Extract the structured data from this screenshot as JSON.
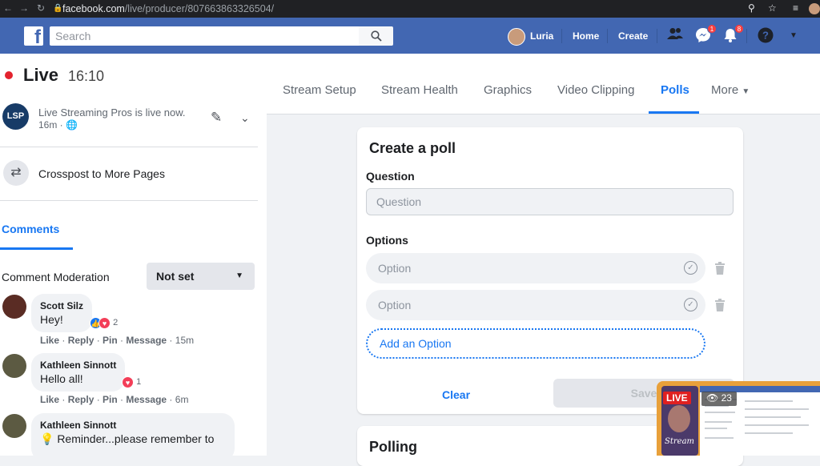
{
  "browser": {
    "url_host": "facebook.com",
    "url_path": "/live/producer/807663863326504/"
  },
  "fb": {
    "search_placeholder": "Search",
    "user_name": "Luria",
    "home_label": "Home",
    "create_label": "Create",
    "messenger_badge": "1",
    "notifications_badge": "8"
  },
  "live": {
    "label": "Live",
    "time": "16:10",
    "page_initials": "LSP",
    "status_text": "Live Streaming Pros is live now.",
    "ago": "16m ·",
    "crosspost_label": "Crosspost to More Pages"
  },
  "comments": {
    "tab_label": "Comments",
    "moderation_label": "Comment Moderation",
    "moderation_value": "Not set",
    "items": [
      {
        "name": "Scott Silz",
        "text": "Hey!",
        "reactions": "2",
        "age": "15m"
      },
      {
        "name": "Kathleen Sinnott",
        "text": "Hello all!",
        "reactions": "1",
        "age": "6m"
      },
      {
        "name": "Kathleen Sinnott",
        "text": "💡 Reminder...please remember to"
      }
    ],
    "action_like": "Like",
    "action_reply": "Reply",
    "action_pin": "Pin",
    "action_message": "Message"
  },
  "tabs": {
    "items": [
      "Stream Setup",
      "Stream Health",
      "Graphics",
      "Video Clipping",
      "Polls",
      "More"
    ],
    "active": "Polls"
  },
  "poll": {
    "title": "Create a poll",
    "question_label": "Question",
    "question_placeholder": "Question",
    "options_label": "Options",
    "option_placeholder": "Option",
    "add_option": "Add an Option",
    "clear": "Clear",
    "save": "Save"
  },
  "polling": {
    "title": "Polling"
  },
  "preview": {
    "live_tag": "LIVE",
    "viewers": "23",
    "cam_caption": "Stream"
  },
  "colors": {
    "fb_blue": "#4267b2",
    "accent": "#1877f2",
    "live_red": "#e3232e"
  }
}
